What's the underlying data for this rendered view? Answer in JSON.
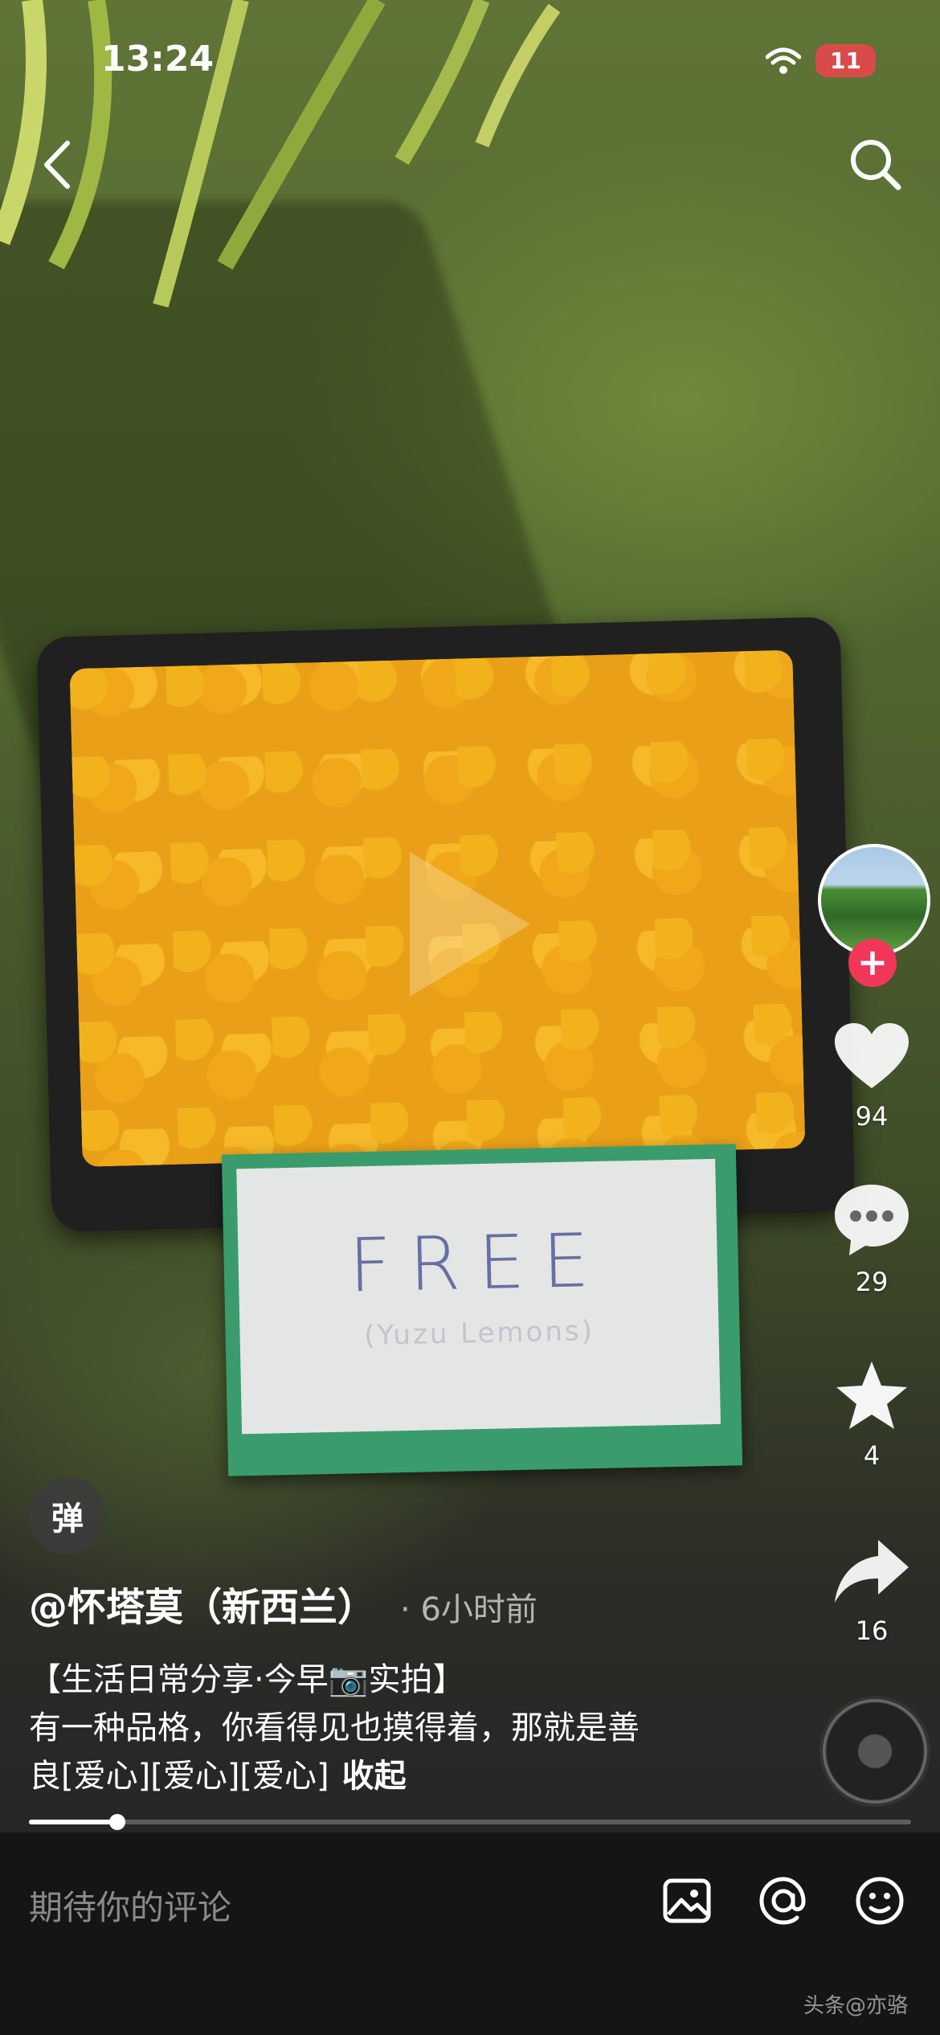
{
  "status_bar": {
    "time": "13:24",
    "battery": "11",
    "wifi_icon": "wifi-icon"
  },
  "top_bar": {
    "back_icon": "chevron-left-icon",
    "search_icon": "search-icon"
  },
  "video": {
    "sign_text": "FREE",
    "sign_subtext": "(Yuzu Lemons)"
  },
  "actions": {
    "like_count": "94",
    "comment_count": "29",
    "favorite_count": "4",
    "share_count": "16"
  },
  "post": {
    "danmu_label": "弹",
    "author": "@怀塔莫（新西兰）",
    "time_ago": "· 6小时前",
    "caption_line1": "【生活日常分享·今早📷实拍】",
    "caption_line2": "有一种品格，你看得见也摸得着，那就是善",
    "caption_line3": "良[爱心][爱心][爱心]",
    "collapse_label": "收起",
    "progress": 0.1
  },
  "comment_bar": {
    "placeholder": "期待你的评论",
    "image_icon": "image-icon",
    "mention_icon": "at-icon",
    "emoji_icon": "emoji-icon"
  },
  "watermark": "头条@亦骆"
}
